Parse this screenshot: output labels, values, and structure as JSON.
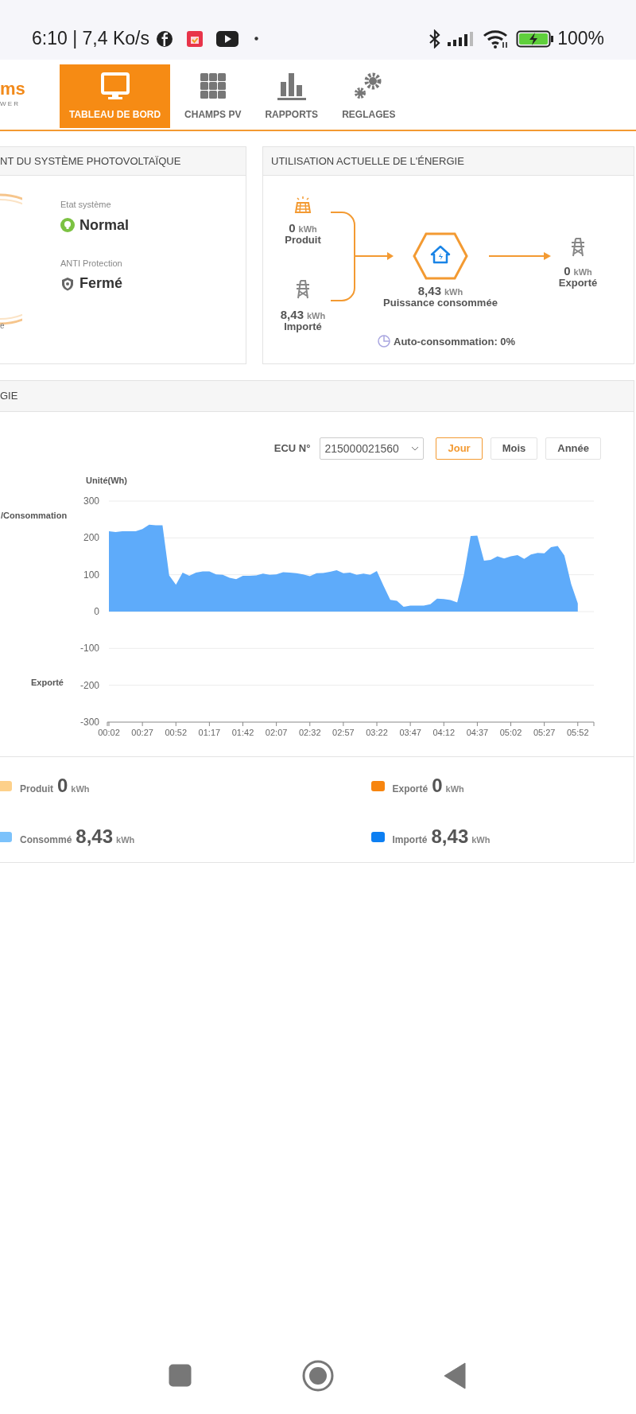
{
  "status_bar": {
    "time": "6:10 | 7,4 Ko/s",
    "battery": "100%"
  },
  "nav": {
    "logo": "ms",
    "logo_sub": "W E R",
    "tabs": [
      {
        "label": "TABLEAU DE BORD",
        "kind": "monitor",
        "selected": true
      },
      {
        "label": "CHAMPS PV",
        "kind": "grid",
        "selected": false
      },
      {
        "label": "RAPPORTS",
        "kind": "bars",
        "selected": false
      },
      {
        "label": "REGLAGES",
        "kind": "gears",
        "selected": false
      }
    ]
  },
  "system_card": {
    "title": "NT DU SYSTÈME PHOTOVOLTAÏQUE",
    "gauge_label": "e",
    "fields": [
      {
        "kind": "status",
        "label": "Etat système",
        "value": "Normal"
      },
      {
        "kind": "shield",
        "label": "ANTI Protection",
        "value": "Fermé"
      }
    ]
  },
  "energy_card": {
    "title": "UTILISATION ACTUELLE DE L'ÉNERGIE",
    "produced": {
      "value": "0",
      "unit": "kWh",
      "label": "Produit"
    },
    "imported": {
      "value": "8,43",
      "unit": "kWh",
      "label": "Importé"
    },
    "consumed": {
      "value": "8,43",
      "unit": "kWh",
      "label": "Puissance consommée"
    },
    "exported": {
      "value": "0",
      "unit": "kWh",
      "label": "Exporté"
    },
    "self_consumption": "Auto-consommation: 0%"
  },
  "chart_card": {
    "title": "GIE",
    "ecu_label": "ECU N°",
    "ecu_value": "215000021560",
    "periods": [
      {
        "label": "Jour",
        "selected": true
      },
      {
        "label": "Mois",
        "selected": false
      },
      {
        "label": "Année",
        "selected": false
      }
    ],
    "side_labels": [
      "/Consommation",
      "Exporté"
    ],
    "chart_data": {
      "type": "area",
      "ylabel": "Unité(Wh)",
      "grid": true,
      "x": [
        2,
        7,
        12,
        17,
        22,
        27,
        32,
        37,
        42,
        47,
        52,
        57,
        62,
        67,
        72,
        77,
        82,
        87,
        92,
        97,
        102,
        107,
        112,
        117,
        122,
        127,
        132,
        137,
        142,
        147,
        152,
        157,
        162,
        167,
        172,
        177,
        182,
        187,
        192,
        197,
        202,
        207,
        212,
        217,
        222,
        227,
        232,
        237,
        242,
        247,
        252,
        257,
        262,
        267,
        272,
        277,
        282,
        287,
        292,
        297,
        302,
        307,
        312,
        317,
        322,
        327,
        332,
        337,
        342,
        347,
        352
      ],
      "xlim": [
        2,
        364
      ],
      "series": [
        {
          "color": "#5eabfa",
          "values": [
            218,
            216,
            218,
            218,
            218,
            224,
            236,
            234,
            234,
            98,
            73,
            106,
            97,
            106,
            109,
            109,
            101,
            100,
            92,
            88,
            97,
            97,
            98,
            103,
            100,
            101,
            107,
            106,
            104,
            101,
            96,
            104,
            105,
            108,
            112,
            104,
            106,
            100,
            103,
            100,
            110,
            70,
            32,
            29,
            13,
            16,
            16,
            16,
            20,
            35,
            34,
            31,
            25,
            99,
            205,
            206,
            138,
            140,
            150,
            144,
            150,
            153,
            143,
            155,
            159,
            158,
            175,
            178,
            152,
            75,
            22
          ]
        }
      ],
      "ylim": [
        -300,
        300
      ],
      "yticks": [
        -300,
        -200,
        -100,
        0,
        100,
        200,
        300
      ],
      "xticks": [
        {
          "value": 2,
          "label": "00:02"
        },
        {
          "value": 27,
          "label": "00:27"
        },
        {
          "value": 52,
          "label": "00:52"
        },
        {
          "value": 77,
          "label": "01:17"
        },
        {
          "value": 102,
          "label": "01:42"
        },
        {
          "value": 127,
          "label": "02:07"
        },
        {
          "value": 152,
          "label": "02:32"
        },
        {
          "value": 177,
          "label": "02:57"
        },
        {
          "value": 202,
          "label": "03:22"
        },
        {
          "value": 227,
          "label": "03:47"
        },
        {
          "value": 252,
          "label": "04:12"
        },
        {
          "value": 277,
          "label": "04:37"
        },
        {
          "value": 302,
          "label": "05:02"
        },
        {
          "value": 327,
          "label": "05:27"
        },
        {
          "value": 352,
          "label": "05:52"
        }
      ]
    },
    "legend": [
      {
        "label": "Produit",
        "value": "0",
        "unit": "kWh",
        "color": "#fdd08a"
      },
      {
        "label": "Exporté",
        "value": "0",
        "unit": "kWh",
        "color": "#f7850f"
      },
      {
        "label": "Consommé",
        "value": "8,43",
        "unit": "kWh",
        "color": "#7cc2fb"
      },
      {
        "label": "Importé",
        "value": "8,43",
        "unit": "kWh",
        "color": "#0d7ff2"
      }
    ]
  }
}
